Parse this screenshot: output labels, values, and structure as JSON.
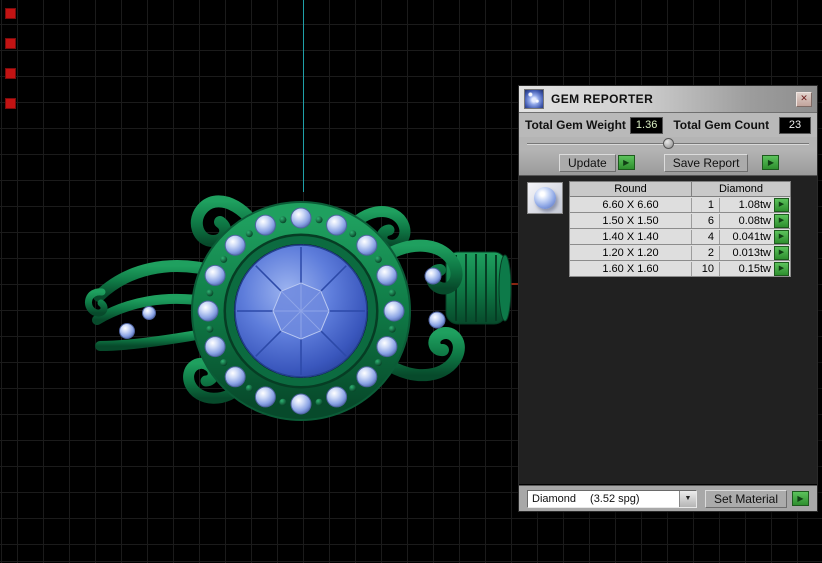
{
  "viewport": {
    "bg_color": "#000000",
    "grid_color": "#1b1b1b",
    "y_axis_color": "#1fa0a8",
    "x_axis_color": "#8e2612",
    "marker_color": "#c21313"
  },
  "icons": {
    "close": "✕",
    "arrow_right": "▶",
    "dropdown": "▼"
  },
  "colors": {
    "accent_green": "#3aa045",
    "weight_value_color": "#d9eec2",
    "count_value_color": "#efefef"
  },
  "panel": {
    "title": "GEM REPORTER",
    "totals": {
      "weight_label": "Total Gem Weight",
      "weight_value": "1.36",
      "count_label": "Total Gem Count",
      "count_value": "23"
    },
    "buttons": {
      "update": "Update",
      "save_report": "Save Report",
      "set_material": "Set Material"
    },
    "table": {
      "col_shape": "Round",
      "col_material": "Diamond",
      "rows": [
        {
          "size": "6.60 X 6.60",
          "count": "1",
          "weight": "1.08tw"
        },
        {
          "size": "1.50 X 1.50",
          "count": "6",
          "weight": "0.08tw"
        },
        {
          "size": "1.40 X 1.40",
          "count": "4",
          "weight": "0.041tw"
        },
        {
          "size": "1.20 X 1.20",
          "count": "2",
          "weight": "0.013tw"
        },
        {
          "size": "1.60 X 1.60",
          "count": "10",
          "weight": "0.15tw"
        }
      ]
    },
    "material": {
      "value": "Diamond",
      "detail": "(3.52 spg)"
    }
  }
}
